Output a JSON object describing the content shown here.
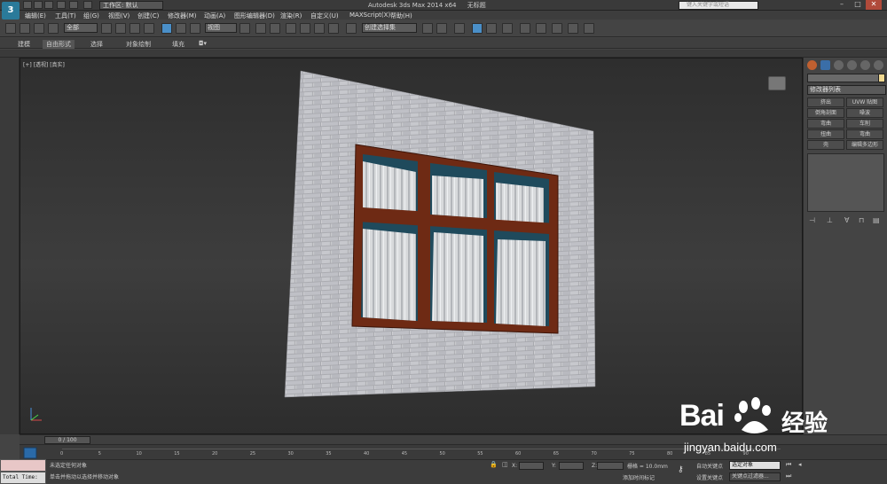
{
  "window": {
    "title": "Autodesk 3ds Max  2014 x64",
    "document": "无标题",
    "workspace_label": "工作区: 默认",
    "search_placeholder": "键入关键字或短语",
    "minimize": "–",
    "maximize": "□",
    "close": "✕"
  },
  "menu": [
    "编辑(E)",
    "工具(T)",
    "组(G)",
    "视图(V)",
    "创建(C)",
    "修改器(M)",
    "动画(A)",
    "图形编辑器(D)",
    "渲染(R)",
    "自定义(U)",
    "MAXScript(X)",
    "帮助(H)"
  ],
  "toolbar": {
    "selection_filter": "全部",
    "ref_coord": "视图",
    "named_selection": "创建选择集"
  },
  "ribbon": {
    "tabs": [
      "建模",
      "自由形式",
      "选择",
      "对象绘制",
      "填充"
    ],
    "active_tab": "自由形式"
  },
  "viewport": {
    "label": "[+] [透视] [真实]"
  },
  "command_panel": {
    "modifier_list": "修改器列表",
    "buttons": [
      [
        "挤出",
        "UVW 贴图"
      ],
      [
        "倒角剖面",
        "噪波"
      ],
      [
        "弯曲",
        "车削"
      ],
      [
        "扭曲",
        "弯曲"
      ],
      [
        "壳",
        "编辑多边形"
      ]
    ]
  },
  "timeline": {
    "slider_label": "0 / 100",
    "ticks": [
      "0",
      "5",
      "10",
      "15",
      "20",
      "25",
      "30",
      "35",
      "40",
      "45",
      "50",
      "55",
      "60",
      "65",
      "70",
      "75",
      "80",
      "85",
      "90"
    ]
  },
  "status": {
    "line1": "未选定任何对象",
    "line2": "单击并拖动以选择并移动对象",
    "total_time": "Total Time:",
    "x_label": "X:",
    "y_label": "Y:",
    "z_label": "Z:",
    "grid": "栅格 = 10.0mm",
    "add_time_tag": "添加时间标记",
    "auto_key": "自动关键点",
    "set_key": "设置关键点",
    "key_selection": "选定对象",
    "key_filters": "关键点过滤器..."
  },
  "watermark": {
    "logo": "Bai",
    "logo_cn": "经验",
    "url": "jingyan.baidu.com"
  }
}
